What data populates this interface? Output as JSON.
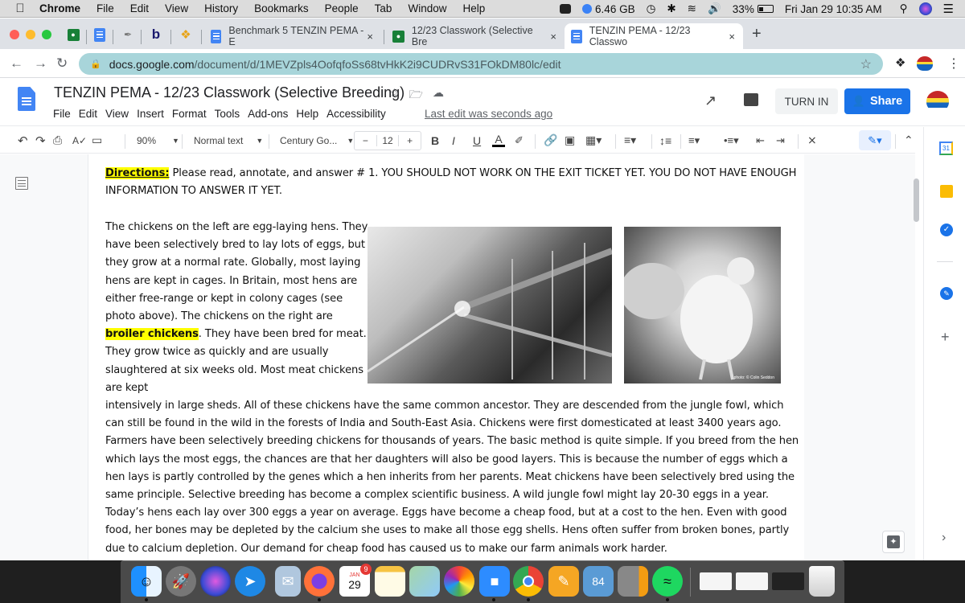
{
  "menubar": {
    "app": "Chrome",
    "items": [
      "File",
      "Edit",
      "View",
      "History",
      "Bookmarks",
      "People",
      "Tab",
      "Window",
      "Help"
    ],
    "status": {
      "memory": "6.46 GB",
      "battery": "33%",
      "datetime": "Fri Jan 29  10:35 AM"
    }
  },
  "tabs": [
    {
      "label": "Benchmark 5 TENZIN PEMA - E",
      "icon": "docs-icon",
      "close": "×"
    },
    {
      "label": "12/23 Classwork (Selective Bre",
      "icon": "classroom-icon",
      "close": "×"
    },
    {
      "label": "TENZIN PEMA - 12/23 Classwo",
      "icon": "docs-icon",
      "close": "×",
      "active": true
    }
  ],
  "new_tab": "+",
  "address": {
    "host": "docs.google.com",
    "path": "/document/d/1MEVZpls4OofqfoSs68tvHkK2i9CUDRvS31FOkDM80lc/edit"
  },
  "doc": {
    "title": "TENZIN PEMA - 12/23 Classwork (Selective Breeding)",
    "menu": [
      "File",
      "Edit",
      "View",
      "Insert",
      "Format",
      "Tools",
      "Add-ons",
      "Help",
      "Accessibility"
    ],
    "last_edit": "Last edit was seconds ago",
    "turn_in": "TURN IN",
    "share": "Share"
  },
  "toolbar": {
    "zoom": "90%",
    "style": "Normal text",
    "font": "Century Go...",
    "size": "12",
    "minus": "−",
    "plus": "+",
    "bold": "B",
    "italic": "I",
    "underline": "U",
    "color": "A"
  },
  "content": {
    "directions_label": "Directions:",
    "directions_text": " Please read, annotate, and answer # 1. YOU SHOULD NOT WORK ON THE EXIT TICKET YET. YOU DO NOT HAVE ENOUGH INFORMATION TO ANSWER IT YET.",
    "left_pre": "The chickens on the left are egg-laying hens. They have been selectively bred to lay lots of eggs, but they grow at a normal rate. Globally, most laying hens are kept in cages. In Britain, most hens are either free-range or kept in colony cages (see photo above). The chickens on the right are ",
    "left_highlight": "broiler chickens",
    "left_post": ". They have been bred for meat. They grow twice as quickly and are usually slaughtered at six weeks old. Most meat chickens are kept",
    "full_para": "intensively in large sheds. All of these chickens have the same common ancestor. They are descended from the jungle fowl, which can still be found in the wild in the forests of India and South-East Asia. Chickens were first domesticated at least 3400 years ago. Farmers have been selectively breeding chickens for thousands of years. The basic method is quite simple. If you breed from the hen which lays the most eggs, the chances are that her daughters will also be good layers. This is because the number of eggs which a hen lays is partly controlled by the genes which a hen inherits from her parents. Meat chickens have been selectively bred using the same principle. Selective breeding has become a complex scientific business. A wild jungle fowl might lay 20-30 eggs in a year. Today’s hens each lay over 300 eggs a year on average. Eggs have become a cheap food, but at a cost to the hen. Even with good food, her bones may be depleted by the calcium she uses to make all those egg shells. Hens often suffer from broken bones, partly due to calcium depletion. Our demand for cheap food has caused us to make our farm animals work harder.",
    "photo_credit": "photo: © Colin Seddon"
  },
  "dock": {
    "calendar_month": "JAN",
    "calendar_day": "29",
    "calendar_badge": "9",
    "dashboard_badge": "84"
  },
  "colors": {
    "accent": "#1a73e8",
    "highlight": "#ffff00",
    "omnibox": "#a8d5da"
  }
}
